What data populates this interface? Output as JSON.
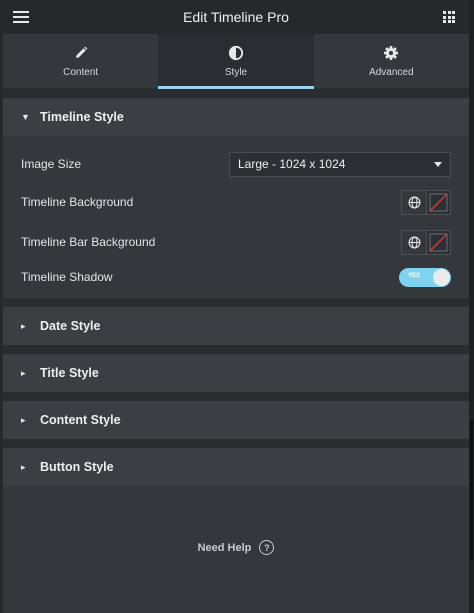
{
  "header": {
    "title": "Edit Timeline Pro",
    "menu_icon": "hamburger-menu-icon",
    "apps_icon": "grid-apps-icon"
  },
  "tabs": [
    {
      "label": "Content",
      "icon": "pencil-icon"
    },
    {
      "label": "Style",
      "icon": "contrast-circle-icon",
      "active": true
    },
    {
      "label": "Advanced",
      "icon": "gear-icon"
    }
  ],
  "sections": {
    "timeline_style": {
      "label": "Timeline Style",
      "expanded": true,
      "image_size": {
        "label": "Image Size",
        "value": "Large - 1024 x 1024"
      },
      "timeline_background": {
        "label": "Timeline Background"
      },
      "timeline_bar_background": {
        "label": "Timeline Bar Background"
      },
      "timeline_shadow": {
        "label": "Timeline Shadow",
        "toggle_text": "YES",
        "enabled": true
      }
    },
    "date_style": {
      "label": "Date Style"
    },
    "title_style": {
      "label": "Title Style"
    },
    "content_style": {
      "label": "Content Style"
    },
    "button_style": {
      "label": "Button Style"
    }
  },
  "footer": {
    "help_label": "Need Help",
    "help_icon_glyph": "?"
  },
  "colors": {
    "accent": "#7fd3ef",
    "panel": "#34383c",
    "header": "#26292c",
    "swatch_slash": "#d63a3a"
  }
}
